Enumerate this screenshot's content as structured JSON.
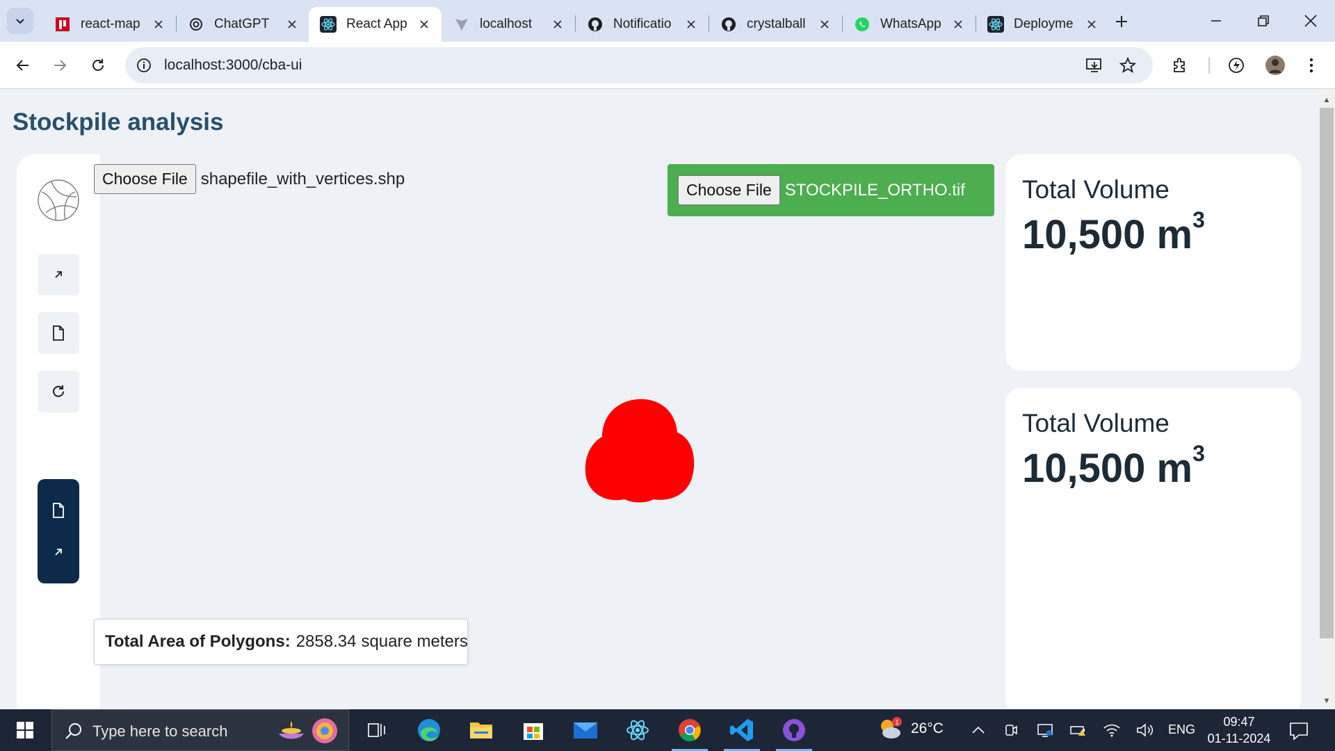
{
  "browser": {
    "tabs": [
      {
        "title": "react-map",
        "icon": "red-square-icon"
      },
      {
        "title": "ChatGPT",
        "icon": "chatgpt-icon"
      },
      {
        "title": "React App",
        "icon": "react-icon",
        "active": true
      },
      {
        "title": "localhost",
        "icon": "vite-icon"
      },
      {
        "title": "Notificatio",
        "icon": "github-icon"
      },
      {
        "title": "crystalball",
        "icon": "github-icon"
      },
      {
        "title": "WhatsApp",
        "icon": "whatsapp-icon"
      },
      {
        "title": "Deployme",
        "icon": "react-icon"
      }
    ],
    "url": "localhost:3000/cba-ui"
  },
  "page": {
    "title": "Stockpile analysis",
    "shapefile": {
      "button_label": "Choose File",
      "file_name": "shapefile_with_vertices.shp"
    },
    "ortho": {
      "button_label": "Choose File",
      "file_name": "STOCKPILE_ORTHO.tif"
    },
    "area": {
      "label": "Total Area of Polygons:",
      "value": "2858.34",
      "unit": "square meters"
    },
    "volume_cards": [
      {
        "label": "Total Volume",
        "value": "10,500 m",
        "sup": "3"
      },
      {
        "label": "Total Volume",
        "value": "10,500 m",
        "sup": "3"
      }
    ],
    "polygon_color": "#ff0000",
    "upload_color": "#4cae4f"
  },
  "taskbar": {
    "search_placeholder": "Type here to search",
    "weather": "26°C",
    "weather_badge": "1",
    "language": "ENG",
    "time": "09:47",
    "date": "01-11-2024"
  }
}
